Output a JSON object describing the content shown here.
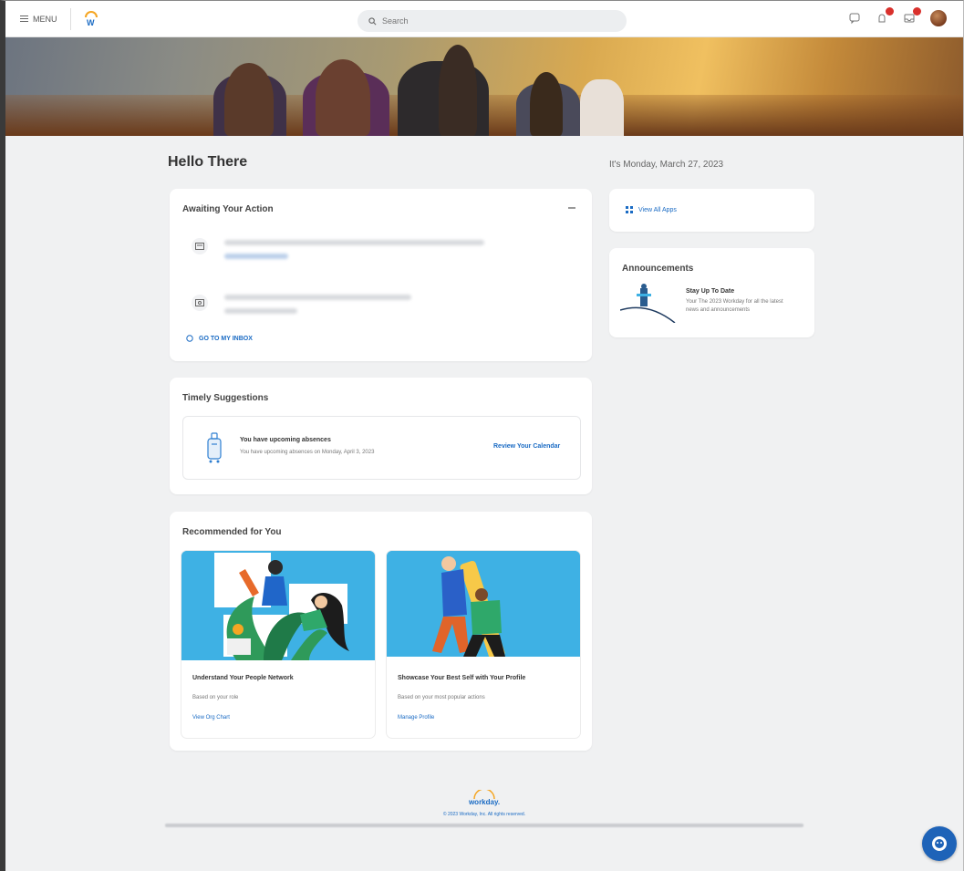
{
  "topbar": {
    "menu_label": "MENU",
    "search_placeholder": "Search"
  },
  "greeting": "Hello There",
  "date_text": "It's Monday, March 27, 2023",
  "awaiting": {
    "title": "Awaiting Your Action",
    "go_to_inbox": "GO TO MY INBOX"
  },
  "timely": {
    "title": "Timely Suggestions",
    "headline": "You have upcoming absences",
    "detail": "You have upcoming absences on Monday, April 3, 2023",
    "action": "Review Your Calendar"
  },
  "recommended": {
    "title": "Recommended for You",
    "cards": [
      {
        "title": "Understand Your People Network",
        "desc": "Based on your role",
        "link": "View Org Chart"
      },
      {
        "title": "Showcase Your Best Self with Your Profile",
        "desc": "Based on your most popular actions",
        "link": "Manage Profile"
      }
    ]
  },
  "apps": {
    "view_all": "View All Apps"
  },
  "announcements": {
    "title": "Announcements",
    "item_title": "Stay Up To Date",
    "item_desc": "Your The 2023 Workday for all the latest news and announcements"
  },
  "footer": {
    "logo_text": "workday.",
    "copyright": "© 2023 Workday, Inc. All rights reserved."
  },
  "colors": {
    "link": "#1a6bc4",
    "badge": "#d9302c",
    "illustration_bg": "#3eb1e4",
    "chat_button": "#1e63b8"
  }
}
